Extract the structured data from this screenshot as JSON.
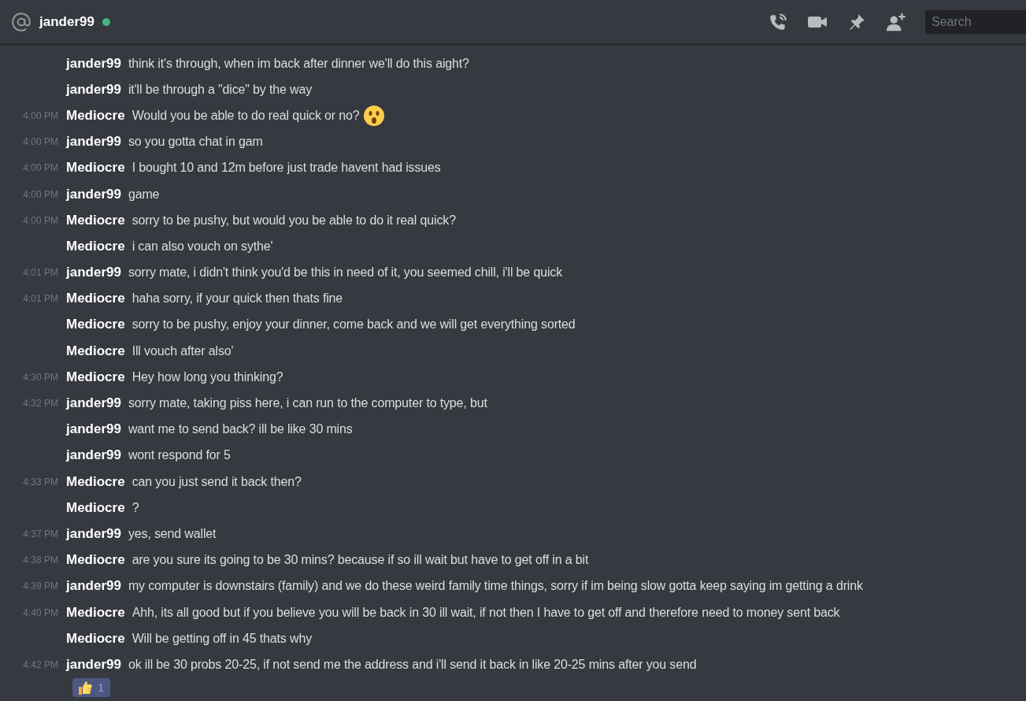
{
  "header": {
    "channel": "jander99",
    "online": true,
    "search": {
      "placeholder": "Search"
    }
  },
  "messages": [
    {
      "author": "jander99",
      "text": "think it's through, when im back after dinner we'll do this aight?"
    },
    {
      "author": "jander99",
      "text": "it'll be through a \"dice\" by the way"
    },
    {
      "time": "4:00 PM",
      "author": "Mediocre",
      "text": "Would you be able to do real quick or no?",
      "emoji": true
    },
    {
      "time": "4:00 PM",
      "author": "jander99",
      "text": "so you gotta chat in gam"
    },
    {
      "time": "4:00 PM",
      "author": "Mediocre",
      "text": "I bought 10 and 12m before just trade havent had issues"
    },
    {
      "time": "4:00 PM",
      "author": "jander99",
      "text": "game"
    },
    {
      "time": "4:00 PM",
      "author": "Mediocre",
      "text": "sorry to be pushy, but would you be able to do it real quick?"
    },
    {
      "author": "Mediocre",
      "text": "i can also vouch on sythe'"
    },
    {
      "time": "4:01 PM",
      "author": "jander99",
      "text": "sorry mate, i didn't think you'd be this in need of it, you seemed chill, i'll be quick"
    },
    {
      "time": "4:01 PM",
      "author": "Mediocre",
      "text": "haha sorry, if your quick then thats fine"
    },
    {
      "author": "Mediocre",
      "text": "sorry to be pushy, enjoy your dinner, come back and we will get everything sorted"
    },
    {
      "author": "Mediocre",
      "text": "Ill vouch after also'"
    },
    {
      "time": "4:30 PM",
      "author": "Mediocre",
      "text": "Hey how long you thinking?"
    },
    {
      "time": "4:32 PM",
      "author": "jander99",
      "text": "sorry mate, taking piss here, i can run to the computer to type, but"
    },
    {
      "author": "jander99",
      "text": "want me to send back? ill be like 30 mins"
    },
    {
      "author": "jander99",
      "text": "wont respond for 5"
    },
    {
      "time": "4:33 PM",
      "author": "Mediocre",
      "text": "can you just send it back then?"
    },
    {
      "author": "Mediocre",
      "text": "?"
    },
    {
      "time": "4:37 PM",
      "author": "jander99",
      "text": "yes, send wallet"
    },
    {
      "time": "4:38 PM",
      "author": "Mediocre",
      "text": "are you sure its going to be 30 mins? because if so ill wait but have to get off in a bit"
    },
    {
      "time": "4:39 PM",
      "author": "jander99",
      "text": "my computer is downstairs (family) and we do these weird family time things, sorry if im being slow gotta keep saying im getting a drink"
    },
    {
      "time": "4:40 PM",
      "author": "Mediocre",
      "text": "Ahh, its all good but if you believe you will be back in 30 ill wait, if not then I have to get off and therefore need to money sent back"
    },
    {
      "author": "Mediocre",
      "text": "Will be getting off in 45 thats why"
    },
    {
      "time": "4:42 PM",
      "author": "jander99",
      "text": "ok ill be 30 probs 20-25, if not send me the address and i'll send it back in like 20-25 mins after you send",
      "reaction": {
        "count": "1",
        "selected": true
      }
    }
  ]
}
